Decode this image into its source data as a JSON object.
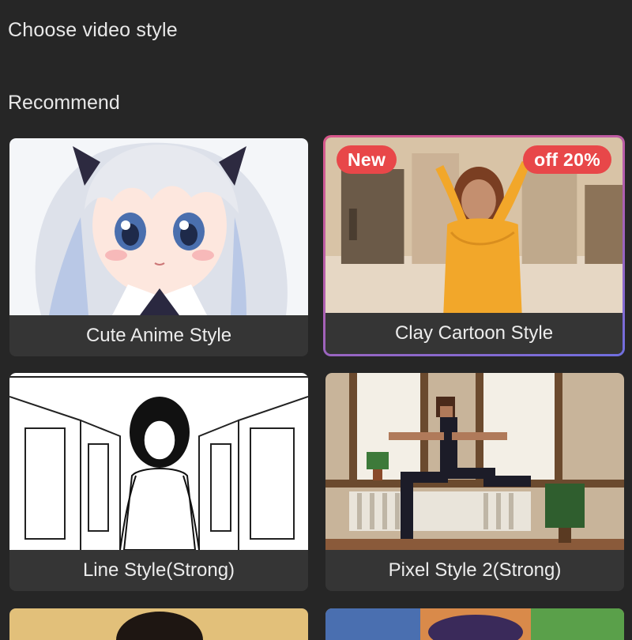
{
  "header": {
    "title": "Choose video style"
  },
  "section": {
    "title": "Recommend"
  },
  "styles": [
    {
      "label": "Cute Anime Style",
      "selected": false
    },
    {
      "label": "Clay Cartoon Style",
      "selected": true,
      "badges": {
        "left": "New",
        "right": "off 20%"
      }
    },
    {
      "label": "Line Style(Strong)",
      "selected": false
    },
    {
      "label": "Pixel Style 2(Strong)",
      "selected": false
    }
  ],
  "colors": {
    "background": "#262626",
    "card": "#353535",
    "badge": "#e84749",
    "selected_border_start": "#d9578a",
    "selected_border_end": "#6f6fe0"
  }
}
